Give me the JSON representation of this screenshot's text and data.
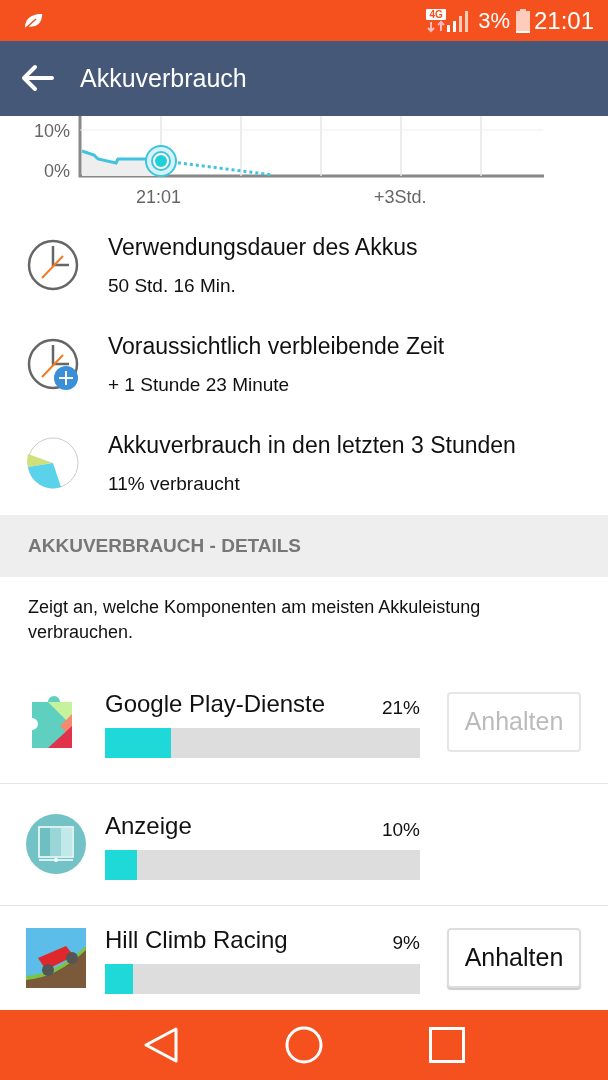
{
  "status_bar": {
    "network": "4G",
    "battery": "3%",
    "time": "21:01"
  },
  "toolbar": {
    "title": "Akkuverbrauch"
  },
  "history_graph": {
    "y_labels": [
      "10%",
      "0%"
    ],
    "x_labels": [
      "21:01",
      "+3Std."
    ]
  },
  "summary": [
    {
      "kind": "clock",
      "title": "Verwendungsdauer des Akkus",
      "value": "50 Std. 16 Min."
    },
    {
      "kind": "clock-plus",
      "title": "Voraussichtlich verbleibende Zeit",
      "value": "+ 1 Stunde 23 Minute"
    },
    {
      "kind": "pie",
      "title": "Akkuverbrauch in den letzten 3 Stunden",
      "value": "11% verbraucht"
    }
  ],
  "details": {
    "header": "AKKUVERBRAUCH - DETAILS",
    "description": "Zeigt an, welche Komponenten am meisten Akkuleistung verbrauchen.",
    "apps": [
      {
        "kind": "puzzle",
        "name": "Google Play-Dienste",
        "percent": "21%",
        "level": 0.21,
        "button": {
          "label": "Anhalten",
          "disabled": true
        }
      },
      {
        "kind": "display",
        "name": "Anzeige",
        "percent": "10%",
        "level": 0.1
      },
      {
        "kind": "game",
        "name": "Hill Climb Racing",
        "percent": "9%",
        "level": 0.09,
        "button": {
          "label": "Anhalten",
          "disabled": false
        }
      }
    ]
  }
}
